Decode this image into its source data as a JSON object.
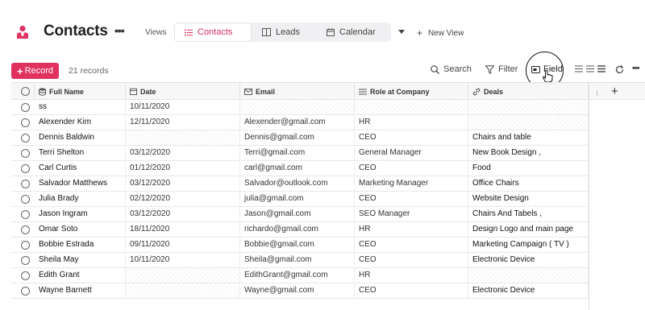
{
  "header": {
    "title": "Contacts",
    "views_label": "Views",
    "tabs": [
      {
        "label": "Contacts",
        "icon": "list-icon",
        "active": true
      },
      {
        "label": "Leads",
        "icon": "table-icon",
        "active": false
      },
      {
        "label": "Calendar",
        "icon": "calendar-icon",
        "active": false
      }
    ],
    "new_view_label": "New View",
    "accent_color": "#e0315f"
  },
  "toolbar": {
    "record_label": "Record",
    "record_count": "21 records",
    "search_label": "Search",
    "filter_label": "Filter",
    "field_label": "Field"
  },
  "table": {
    "columns": [
      {
        "label": "Full Name",
        "icon": "database-icon"
      },
      {
        "label": "Date",
        "icon": "calendar-icon"
      },
      {
        "label": "Email",
        "icon": "mail-icon"
      },
      {
        "label": "Role at Company",
        "icon": "list-icon"
      },
      {
        "label": "Deals",
        "icon": "link-icon"
      }
    ],
    "rows": [
      {
        "name": "ss",
        "date": "10/11/2020",
        "email": "",
        "role": "",
        "deals": ""
      },
      {
        "name": "Alexender Kim",
        "date": "12/11/2020",
        "email": "Alexender@gmail.com",
        "role": "HR",
        "deals": ""
      },
      {
        "name": "Dennis Baldwin",
        "date": "",
        "email": "Dennis@gmail.com",
        "role": "CEO",
        "deals": "Chairs and table"
      },
      {
        "name": "Terri Shelton",
        "date": "03/12/2020",
        "email": "Terri@gmail.com",
        "role": "General Manager",
        "deals": "New Book Design ,"
      },
      {
        "name": "Carl Curtis",
        "date": "01/12/2020",
        "email": "carl@gmail.com",
        "role": "CEO",
        "deals": "Food"
      },
      {
        "name": "Salvador Matthews",
        "date": "03/12/2020",
        "email": "Salvador@outlook.com",
        "role": "Marketing Manager",
        "deals": "Office Chairs"
      },
      {
        "name": "Julia Brady",
        "date": "02/12/2020",
        "email": "julia@gmail.com",
        "role": "CEO",
        "deals": "Website Design"
      },
      {
        "name": "Jason Ingram",
        "date": "03/12/2020",
        "email": "Jason@gmail.com",
        "role": "SEO Manager",
        "deals": "Chairs And Tabels ,"
      },
      {
        "name": "Omar Soto",
        "date": "18/11/2020",
        "email": "richardo@gmail.com",
        "role": "HR",
        "deals": "Design Logo and main page"
      },
      {
        "name": "Bobbie Estrada",
        "date": "09/11/2020",
        "email": "Bobbie@gmail.com",
        "role": "CEO",
        "deals": "Marketing Campaign ( TV )"
      },
      {
        "name": "Sheila May",
        "date": "10/11/2020",
        "email": "Sheila@gmail.com",
        "role": "CEO",
        "deals": "Electronic Device"
      },
      {
        "name": "Edith Grant",
        "date": "",
        "email": "EdithGrant@gmail.com",
        "role": "HR",
        "deals": ""
      },
      {
        "name": "Wayne Barnett",
        "date": "",
        "email": "Wayne@gmail.com",
        "role": "CEO",
        "deals": "Electronic Device"
      }
    ]
  }
}
